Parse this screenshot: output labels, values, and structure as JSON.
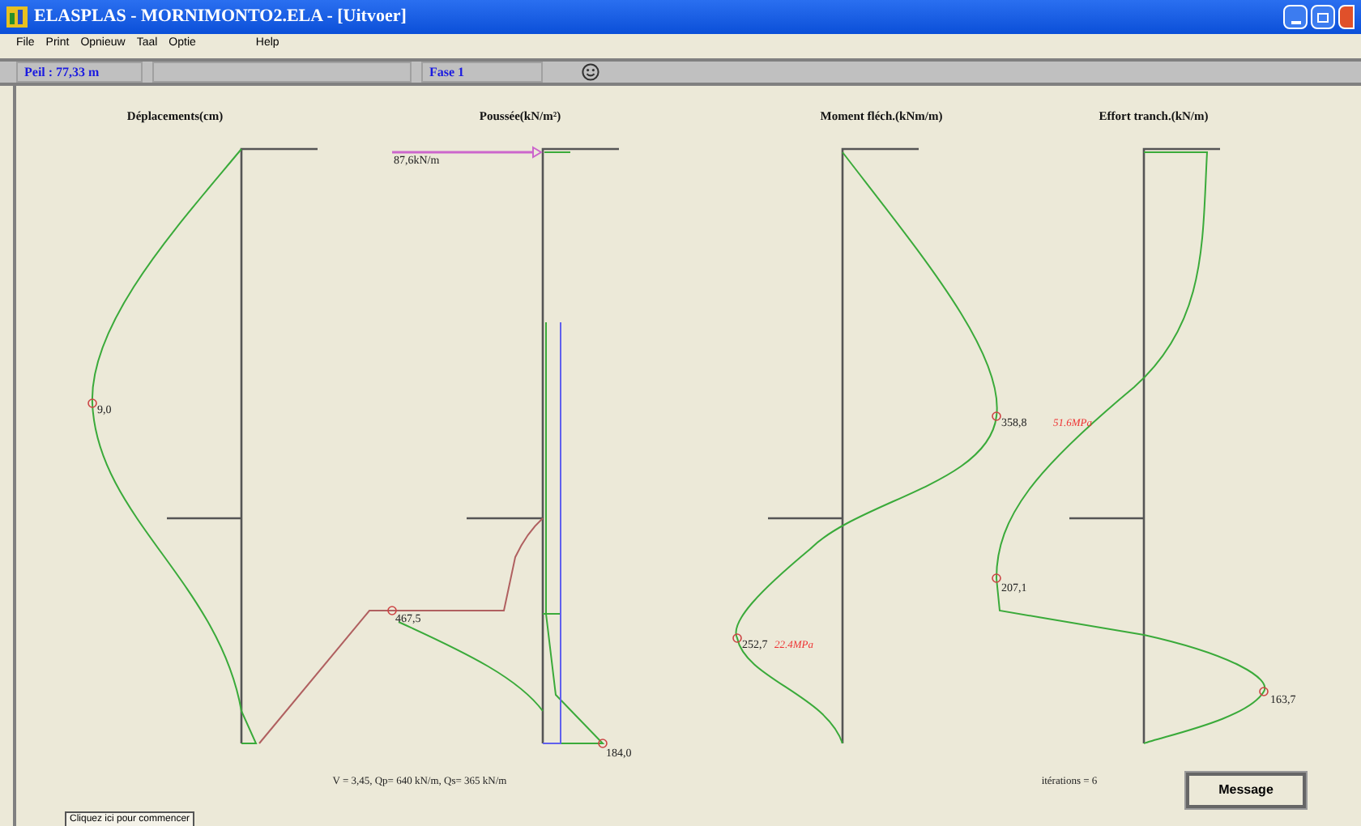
{
  "window": {
    "title": "ELASPLAS - MORNIMONTO2.ELA - [Uitvoer]"
  },
  "menu": [
    "File",
    "Print",
    "Opnieuw",
    "Taal",
    "Optie",
    "Help"
  ],
  "status_bar": {
    "level_field": "Peil : 77,33 m",
    "phase_field": "Fase 1"
  },
  "plots": [
    {
      "title": "Déplacements(cm)",
      "labels": [
        {
          "text": "9,0",
          "kind": "value"
        }
      ]
    },
    {
      "title": "Poussée(kN/m²)",
      "labels": [
        {
          "text": "87,6kN/m",
          "kind": "value"
        },
        {
          "text": "467,5",
          "kind": "value"
        },
        {
          "text": "184,0",
          "kind": "value"
        }
      ]
    },
    {
      "title": "Moment fléch.(kNm/m)",
      "labels": [
        {
          "text": "358,8",
          "kind": "value"
        },
        {
          "text": "51.6MPa",
          "kind": "stress"
        },
        {
          "text": "252,7",
          "kind": "value"
        },
        {
          "text": "22.4MPa",
          "kind": "stress"
        }
      ]
    },
    {
      "title": "Effort tranch.(kN/m)",
      "labels": [
        {
          "text": "207,1",
          "kind": "value"
        },
        {
          "text": "163,7",
          "kind": "value"
        }
      ]
    }
  ],
  "summary": "V = 3,45, Qp= 640 kN/m, Qs= 365 kN/m",
  "iterations": "itérations = 6",
  "buttons": {
    "message": "Message",
    "start": "Cliquez ici pour commencer"
  }
}
